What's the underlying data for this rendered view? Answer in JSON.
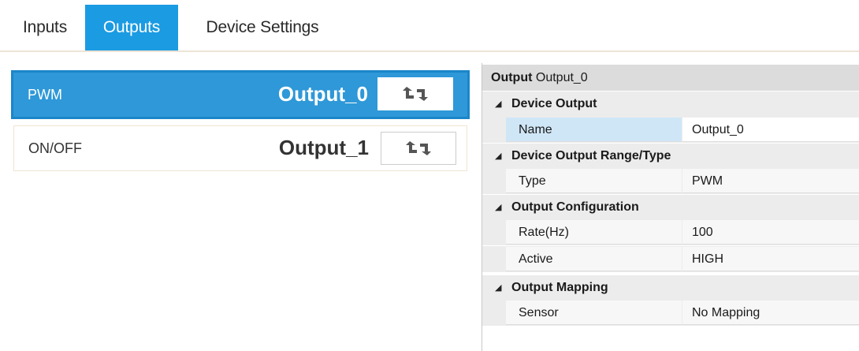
{
  "tabs": [
    {
      "label": "Inputs"
    },
    {
      "label": "Outputs",
      "active": true
    },
    {
      "label": "Device Settings"
    }
  ],
  "outputs": [
    {
      "type": "PWM",
      "name": "Output_0",
      "selected": true
    },
    {
      "type": "ON/OFF",
      "name": "Output_1",
      "selected": false
    }
  ],
  "properties": {
    "header_prefix": "Output",
    "header_name": "Output_0",
    "categories": [
      {
        "label": "Device Output",
        "rows": [
          {
            "name": "Name",
            "value": "Output_0"
          }
        ]
      },
      {
        "label": "Device Output Range/Type",
        "rows": [
          {
            "name": "Type",
            "value": "PWM"
          }
        ]
      },
      {
        "label": "Output Configuration",
        "rows": [
          {
            "name": "Rate(Hz)",
            "value": "100"
          },
          {
            "name": "Active",
            "value": "HIGH"
          }
        ]
      },
      {
        "label": "Output Mapping",
        "rows": [
          {
            "name": "Sensor",
            "value": "No Mapping"
          }
        ]
      }
    ]
  },
  "colors": {
    "accent": "#1b9be2",
    "selected_row": "#2e98d8",
    "category_bg": "#ececec",
    "header_bg": "#dcdcdc"
  },
  "icons": {
    "refresh": "refresh-icon",
    "collapse": "collapse-triangle-icon"
  }
}
